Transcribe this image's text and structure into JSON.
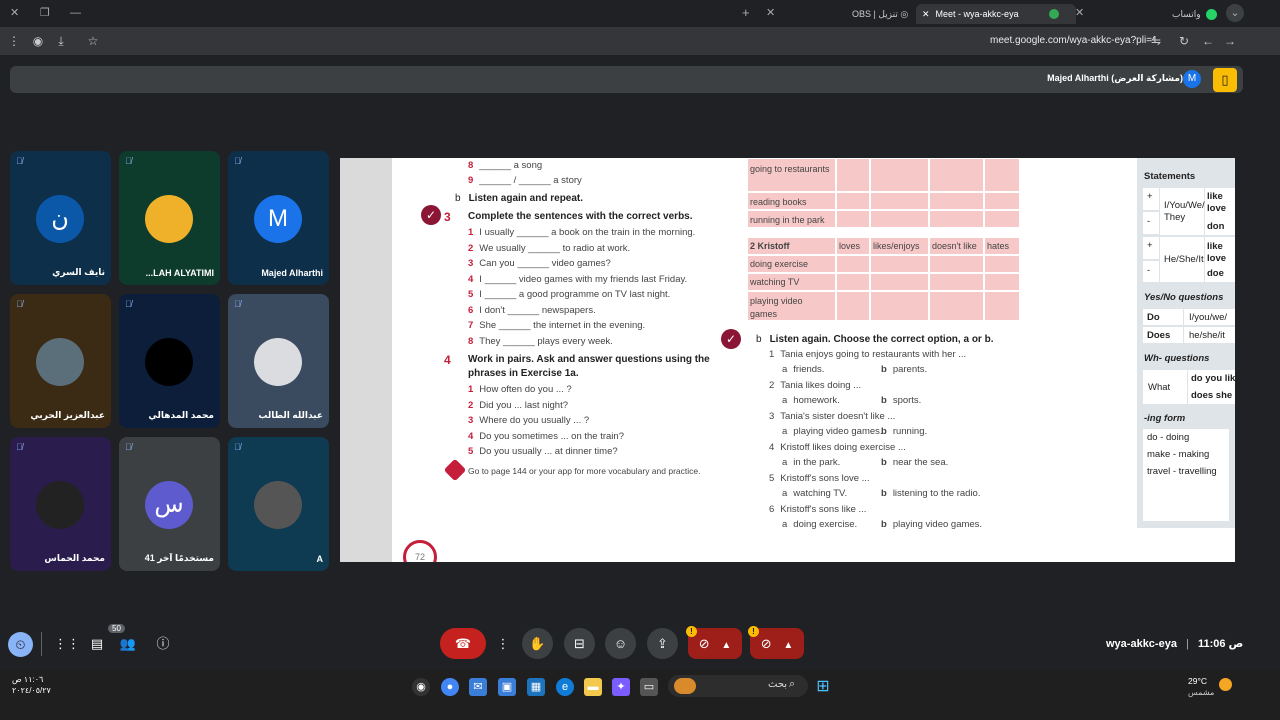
{
  "browser": {
    "tabs": [
      {
        "label": "واتساب"
      },
      {
        "label": "Meet - wya-akkc-eya"
      },
      {
        "label": "OBS | تنزيل"
      }
    ],
    "new_tab": "+",
    "url": "meet.google.com/wya-akkc-eya?pli=1"
  },
  "banner": {
    "presenter": "Majed Alharthi (مشاركة العرض)",
    "avatar_letter": "M"
  },
  "tiles": [
    {
      "name": "نايف السري",
      "letter": "ن",
      "avatar_color": "#0b57a8",
      "bg": "#0e2f4a"
    },
    {
      "name": "...LAH ALYATIMI",
      "letter": "",
      "avatar_color": "#f0b12a",
      "bg": "#0d3b2c"
    },
    {
      "name": "Majed Alharthi",
      "letter": "M",
      "avatar_color": "#1a73e8",
      "bg": "#0e2f4a"
    },
    {
      "name": "عبدالعزيز الحربي",
      "letter": "",
      "avatar_color": "#5a6f7a",
      "bg": "#3b2a14"
    },
    {
      "name": "محمد المدهالي",
      "letter": "",
      "avatar_color": "#000000",
      "bg": "#0c1e3a"
    },
    {
      "name": "عبدالله الطالب",
      "letter": "",
      "avatar_color": "#dadce0",
      "bg": "#3a4a5f"
    },
    {
      "name": "محمد الحماس",
      "letter": "",
      "avatar_color": "#222222",
      "bg": "#2a1d4e"
    },
    {
      "name": "41 مستخدمًا آخر",
      "letter": "س",
      "avatar_color": "#5e5bcf",
      "bg": "#3c4043"
    },
    {
      "name": "A",
      "letter": "",
      "avatar_color": "#555555",
      "bg": "#0e3a52"
    }
  ],
  "doc": {
    "left_top": [
      {
        "n": "8",
        "text": "______ a song"
      },
      {
        "n": "9",
        "text": "______ / ______ a story"
      }
    ],
    "ex3b": {
      "label": "b",
      "text": "Listen again and repeat."
    },
    "ex3": {
      "num": "3",
      "title": "Complete the sentences with the correct verbs."
    },
    "ex3_items": [
      {
        "n": "1",
        "text": "I usually ______ a book on the train in the morning."
      },
      {
        "n": "2",
        "text": "We usually ______ to radio at work."
      },
      {
        "n": "3",
        "text": "Can you ______ video games?"
      },
      {
        "n": "4",
        "text": "I ______ video games with my friends last Friday."
      },
      {
        "n": "5",
        "text": "I ______ a good programme on TV last night."
      },
      {
        "n": "6",
        "text": "I don't ______ newspapers."
      },
      {
        "n": "7",
        "text": "She ______ the internet in the evening."
      },
      {
        "n": "8",
        "text": "They ______ plays every week."
      }
    ],
    "ex4": {
      "num": "4",
      "title1": "Work in pairs. Ask and answer questions using the",
      "title2": "phrases in Exercise 1a."
    },
    "ex4_items": [
      {
        "n": "1",
        "text": "How often do you ... ?"
      },
      {
        "n": "2",
        "text": "Did you ... last night?"
      },
      {
        "n": "3",
        "text": "Where do you usually ... ?"
      },
      {
        "n": "4",
        "text": "Do you sometimes ... on the train?"
      },
      {
        "n": "5",
        "text": "Do you usually ... at dinner time?"
      }
    ],
    "goto": "Go to page 144 or your app for more vocabulary and practice.",
    "page": "72",
    "table1_rows": [
      "going to restaurants",
      "reading books",
      "running in the park"
    ],
    "table2_head": {
      "title": "2 Kristoff",
      "c1": "loves",
      "c2": "likes/enjoys",
      "c3": "doesn't like",
      "c4": "hates"
    },
    "table2_rows": [
      "doing exercise",
      "watching TV",
      "playing video games"
    ],
    "exb": {
      "label": "b",
      "title": "Listen again. Choose the correct option, a or b."
    },
    "exb_items": [
      {
        "n": "1",
        "q": "Tania enjoys going to restaurants with her ...",
        "a": "friends.",
        "b": "parents."
      },
      {
        "n": "2",
        "q": "Tania likes doing ...",
        "a": "homework.",
        "b": "sports."
      },
      {
        "n": "3",
        "q": "Tania's sister doesn't like ...",
        "a": "playing video games.",
        "b": "running."
      },
      {
        "n": "4",
        "q": "Kristoff likes doing exercise ...",
        "a": "in the park.",
        "b": "near the sea."
      },
      {
        "n": "5",
        "q": "Kristoff's sons love ...",
        "a": "watching TV.",
        "b": "listening to the radio."
      },
      {
        "n": "6",
        "q": "Kristoff's sons like ...",
        "a": "doing exercise.",
        "b": "playing video games."
      }
    ],
    "grammar": {
      "statements": "Statements",
      "plus": "+",
      "minus": "-",
      "iyouwe": "I/You/We/",
      "they": "They",
      "heshe": "He/She/It",
      "lik1": "like",
      "lov1": "love",
      "don1": "don",
      "lik2": "like",
      "lov2": "love",
      "doe2": "doe",
      "yesno": "Yes/No questions",
      "do": "Do",
      "does": "Does",
      "iyou2": "I/you/we/",
      "heshe2": "he/she/it",
      "wh": "Wh- questions",
      "what": "What",
      "doyou": "do you lik",
      "doesshe": "does she",
      "ing": "-ing form",
      "ing1": "do - doing",
      "ing2": "make - making",
      "ing3": "travel - travelling"
    }
  },
  "controls": {
    "meet_code": "wya-akkc-eya",
    "separator": "|",
    "time": "11:06 ص",
    "people_count": "50",
    "hangup_icon": "phone-hangup-icon"
  },
  "taskbar": {
    "search": "بحث",
    "weather_temp": "29°C",
    "weather_desc": "مشمس",
    "clock_time": "١١:٠٦ ص",
    "clock_date": "٢٠٢٤/٠٥/٢٧"
  }
}
